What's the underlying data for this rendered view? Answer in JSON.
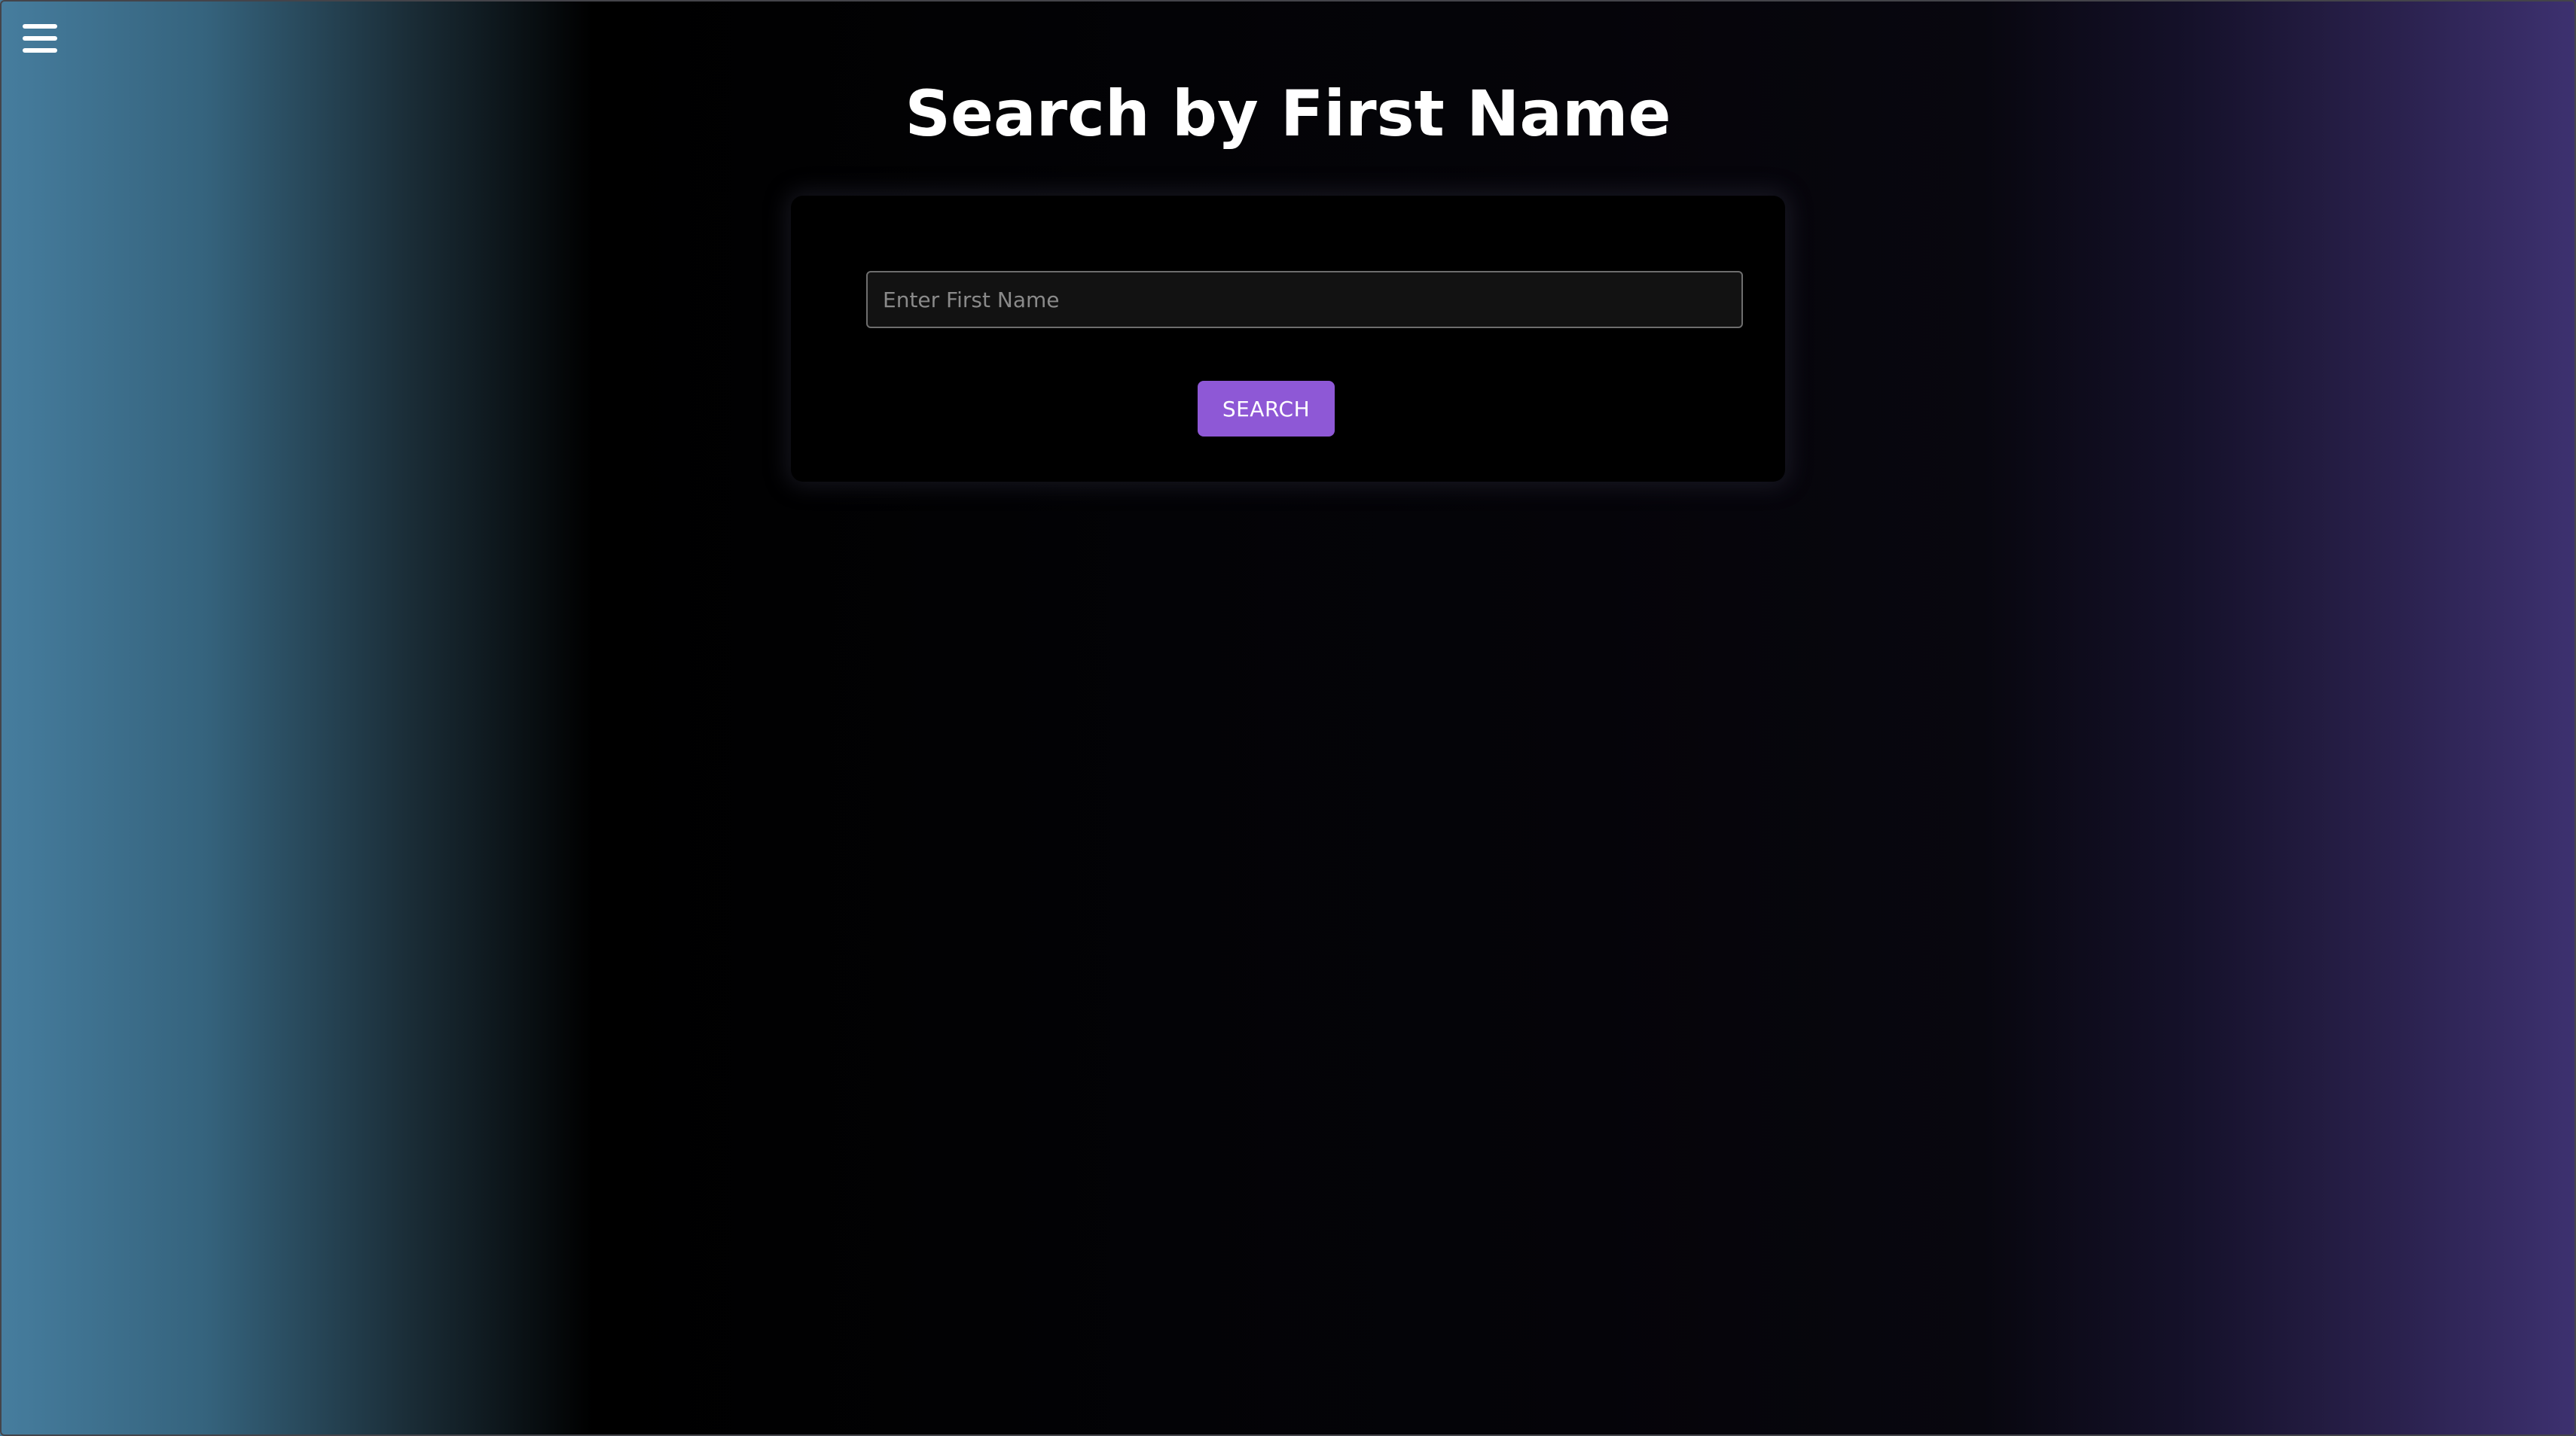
{
  "nav": {
    "menu_icon": "hamburger-menu-icon"
  },
  "page": {
    "title": "Search by First Name"
  },
  "search": {
    "placeholder": "Enter First Name",
    "value": "",
    "button_label": "SEARCH"
  },
  "colors": {
    "button_accent": "#8e58d6",
    "gradient_left": "#467d9e",
    "gradient_center": "#000000",
    "gradient_right": "#3d3170"
  }
}
